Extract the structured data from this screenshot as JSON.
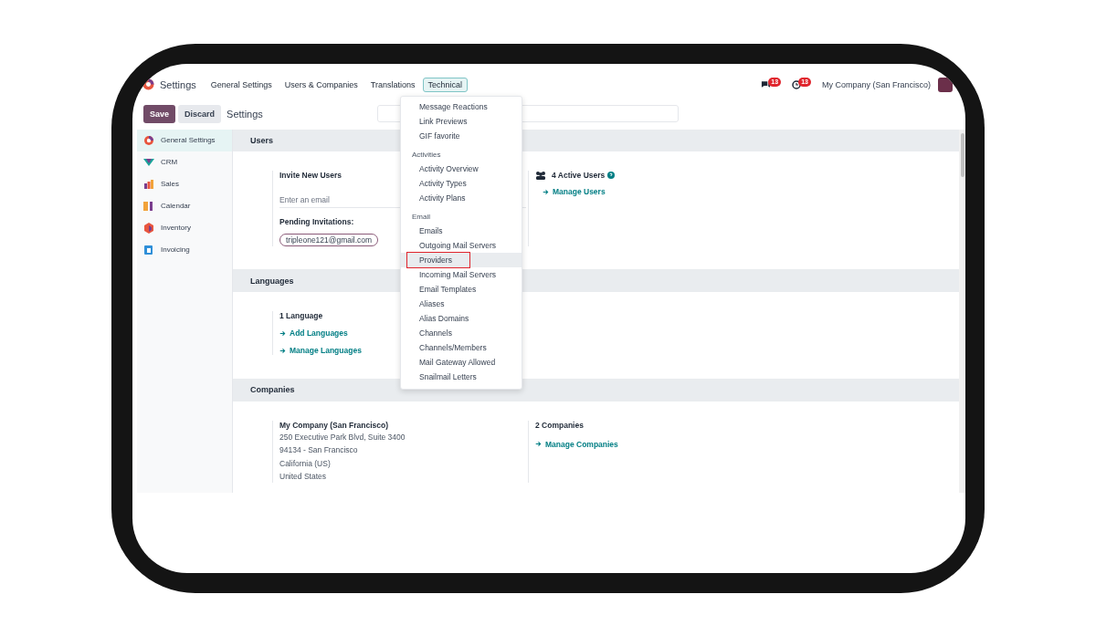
{
  "app": {
    "title": "Settings"
  },
  "nav_menu": [
    {
      "label": "General Settings",
      "selected": false
    },
    {
      "label": "Users & Companies",
      "selected": false
    },
    {
      "label": "Translations",
      "selected": false
    },
    {
      "label": "Technical",
      "selected": true
    }
  ],
  "systray": {
    "messages_count": "13",
    "activities_count": "13",
    "company": "My Company (San Francisco)"
  },
  "control_panel": {
    "buttons": [
      {
        "label": "Save",
        "kind": "primary"
      },
      {
        "label": "Discard",
        "kind": "secondary"
      }
    ],
    "breadcrumb": "Settings"
  },
  "sidebar": {
    "items": [
      {
        "label": "General Settings",
        "selected": true,
        "kind": "settings"
      },
      {
        "label": "CRM",
        "selected": false,
        "kind": "crm"
      },
      {
        "label": "Sales",
        "selected": false,
        "kind": "sales"
      },
      {
        "label": "Calendar",
        "selected": false,
        "kind": "calendar"
      },
      {
        "label": "Inventory",
        "selected": false,
        "kind": "inventory"
      },
      {
        "label": "Invoicing",
        "selected": false,
        "kind": "invoicing"
      }
    ]
  },
  "users": {
    "title": "Users",
    "invite_title": "Invite New Users",
    "email_placeholder": "Enter an email",
    "pending_label": "Pending Invitations:",
    "pending": [
      "tripleone121@gmail.com"
    ],
    "active_users": "4 Active Users",
    "manage_link": "Manage Users"
  },
  "languages": {
    "title": "Languages",
    "count": "1 Language",
    "links": [
      "Add Languages",
      "Manage Languages"
    ]
  },
  "companies": {
    "title": "Companies",
    "company_name": "My Company (San Francisco)",
    "address": [
      "250 Executive Park Blvd, Suite 3400",
      "94134 - San Francisco",
      "California (US)",
      "United States"
    ],
    "count": "2 Companies",
    "manage_link": "Manage Companies"
  },
  "dropdown": {
    "items": [
      {
        "kind": "item",
        "label": "Message Reactions",
        "highlighted": false
      },
      {
        "kind": "item",
        "label": "Link Previews",
        "highlighted": false
      },
      {
        "kind": "item",
        "label": "GIF favorite",
        "highlighted": false
      },
      {
        "kind": "header",
        "label": "Activities"
      },
      {
        "kind": "item",
        "label": "Activity Overview",
        "highlighted": false
      },
      {
        "kind": "item",
        "label": "Activity Types",
        "highlighted": false
      },
      {
        "kind": "item",
        "label": "Activity Plans",
        "highlighted": false
      },
      {
        "kind": "header",
        "label": "Email"
      },
      {
        "kind": "item",
        "label": "Emails",
        "highlighted": false
      },
      {
        "kind": "item",
        "label": "Outgoing Mail Servers",
        "highlighted": false
      },
      {
        "kind": "item",
        "label": "Providers",
        "highlighted": true
      },
      {
        "kind": "item",
        "label": "Incoming Mail Servers",
        "highlighted": false
      },
      {
        "kind": "item",
        "label": "Email Templates",
        "highlighted": false
      },
      {
        "kind": "item",
        "label": "Aliases",
        "highlighted": false
      },
      {
        "kind": "item",
        "label": "Alias Domains",
        "highlighted": false
      },
      {
        "kind": "item",
        "label": "Channels",
        "highlighted": false
      },
      {
        "kind": "item",
        "label": "Channels/Members",
        "highlighted": false
      },
      {
        "kind": "item",
        "label": "Mail Gateway Allowed",
        "highlighted": false
      },
      {
        "kind": "item",
        "label": "Snailmail Letters",
        "highlighted": false
      }
    ]
  }
}
